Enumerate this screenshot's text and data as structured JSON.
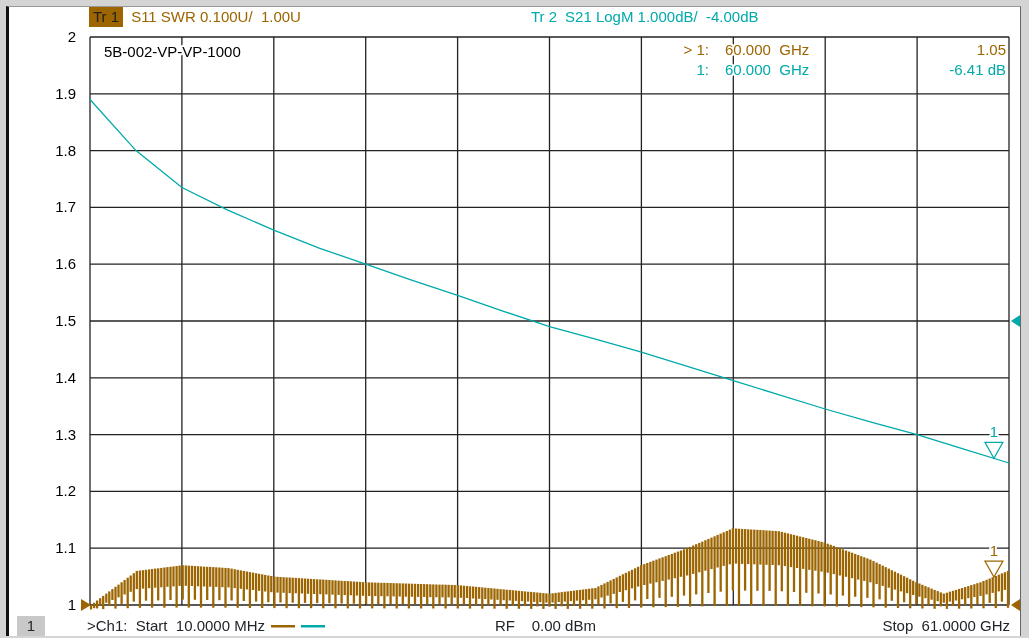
{
  "header": {
    "traces": [
      {
        "label": "Tr 1",
        "description": "S11 SWR 0.100U/  1.00U",
        "selected": true,
        "color": "#9c6500"
      },
      {
        "label": "Tr 2",
        "description": "S21 LogM 1.000dB/  -4.00dB",
        "selected": false,
        "color": "#00aaaa"
      }
    ]
  },
  "chart_data": {
    "type": "line",
    "title": "5B-002-VP-VP-1000",
    "categories": [
      null,
      null,
      null,
      null,
      null,
      null,
      null,
      null,
      null,
      null,
      null,
      null,
      null,
      null,
      null,
      null,
      null,
      null,
      null,
      null,
      null
    ],
    "ylim": [
      1,
      2
    ],
    "grid": true,
    "yticks": [
      1,
      1.1,
      1.2,
      1.3,
      1.4,
      1.5,
      1.6,
      1.7,
      1.8,
      1.9,
      2
    ],
    "series": [
      {
        "color": "#00aaaa",
        "values": [
          1.89,
          1.8,
          1.735,
          1.695,
          1.66,
          1.628,
          1.6,
          1.572,
          1.545,
          1.517,
          1.49,
          1.468,
          1.445,
          1.42,
          1.395,
          1.37,
          1.345,
          1.322,
          1.3,
          1.275,
          1.25
        ]
      }
    ]
  },
  "markers": [
    {
      "id": "> 1:",
      "frequency": "60.000  GHz",
      "value": "1.05",
      "kind": "reflection"
    },
    {
      "id": "1:",
      "frequency": "60.000  GHz",
      "value": "-6.41 dB",
      "kind": "transmission"
    }
  ],
  "trace_markers": [
    {
      "label": "1",
      "color": "#00aaaa"
    },
    {
      "label": "1",
      "color": "#9c6500"
    }
  ],
  "footer": {
    "channel": "1",
    "start": ">Ch1:  Start  10.0000 MHz",
    "power": "RF    0.00 dBm",
    "stop": "Stop  61.0000 GHz"
  }
}
